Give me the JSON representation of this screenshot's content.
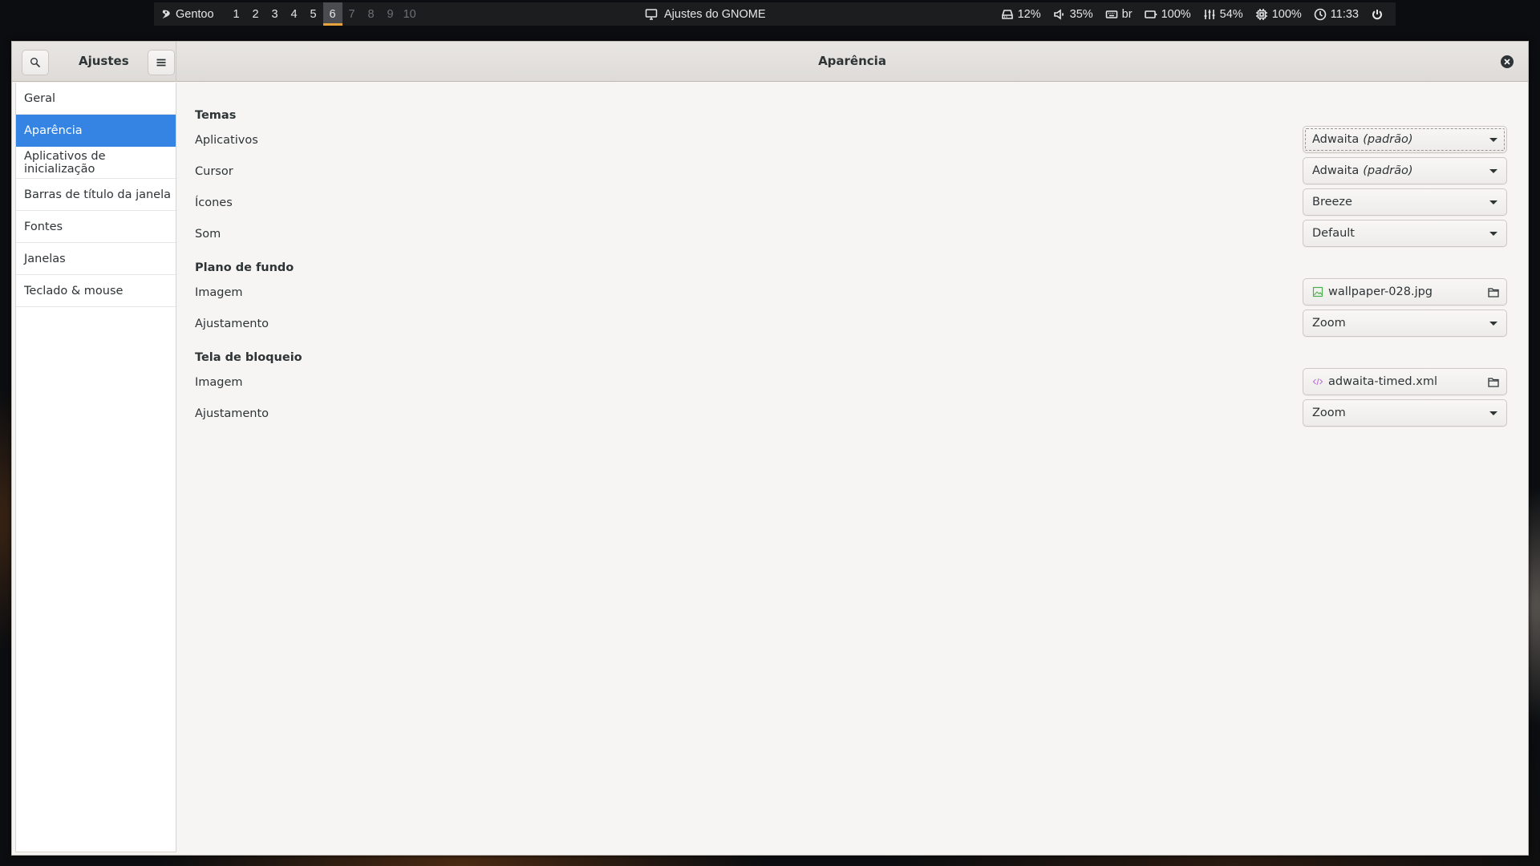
{
  "topbar": {
    "distro": "Gentoo",
    "workspaces": [
      {
        "label": "1",
        "state": "occupied"
      },
      {
        "label": "2",
        "state": "occupied"
      },
      {
        "label": "3",
        "state": "occupied"
      },
      {
        "label": "4",
        "state": "occupied"
      },
      {
        "label": "5",
        "state": "occupied"
      },
      {
        "label": "6",
        "state": "active"
      },
      {
        "label": "7",
        "state": "empty"
      },
      {
        "label": "8",
        "state": "empty"
      },
      {
        "label": "9",
        "state": "empty"
      },
      {
        "label": "10",
        "state": "empty"
      }
    ],
    "window_title": "Ajustes do GNOME",
    "indicators": {
      "disk": "12%",
      "volume": "35%",
      "keyboard": "br",
      "battery": "100%",
      "mixer": "54%",
      "cpu": "100%",
      "clock": "11:33"
    },
    "accent_color": "#e8a33a"
  },
  "window": {
    "app_title": "Ajustes",
    "page_title": "Aparência",
    "sidebar": {
      "selected_index": 1,
      "items": [
        {
          "label": "Geral"
        },
        {
          "label": "Aparência"
        },
        {
          "label": "Aplicativos de inicialização"
        },
        {
          "label": "Barras de título da janela"
        },
        {
          "label": "Fontes"
        },
        {
          "label": "Janelas"
        },
        {
          "label": "Teclado & mouse"
        }
      ]
    },
    "accent_color": "#3584e4",
    "sections": {
      "temas": {
        "title": "Temas",
        "aplicativos": {
          "label": "Aplicativos",
          "value": "Adwaita",
          "suffix": "(padrão)"
        },
        "cursor": {
          "label": "Cursor",
          "value": "Adwaita",
          "suffix": "(padrão)"
        },
        "icones": {
          "label": "Ícones",
          "value": "Breeze"
        },
        "som": {
          "label": "Som",
          "value": "Default"
        }
      },
      "plano_de_fundo": {
        "title": "Plano de fundo",
        "imagem": {
          "label": "Imagem",
          "file": "wallpaper-028.jpg"
        },
        "ajustamento": {
          "label": "Ajustamento",
          "value": "Zoom"
        }
      },
      "tela_de_bloqueio": {
        "title": "Tela de bloqueio",
        "imagem": {
          "label": "Imagem",
          "file": "adwaita-timed.xml"
        },
        "ajustamento": {
          "label": "Ajustamento",
          "value": "Zoom"
        }
      }
    }
  }
}
